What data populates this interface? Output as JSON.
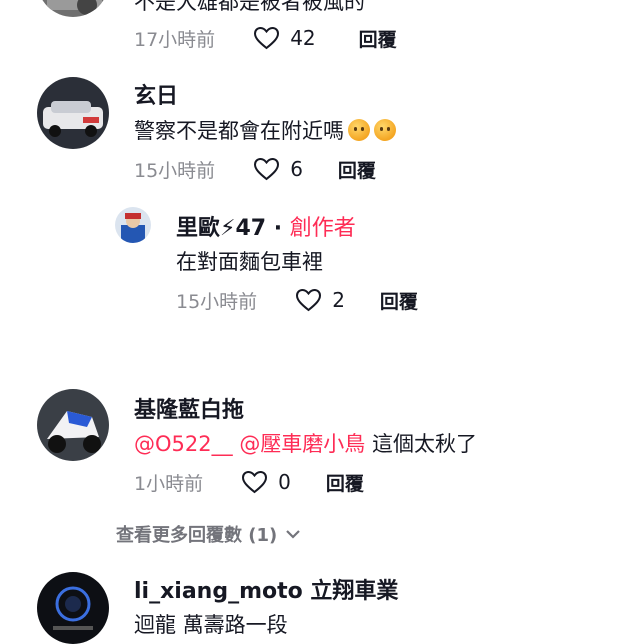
{
  "comments": [
    {
      "text_fragment": "不是大雄都是被者被風的",
      "time": "17小時前",
      "likes": "42",
      "reply": "回覆"
    },
    {
      "username": "玄日",
      "text": "警察不是都會在附近嗎",
      "emojis": [
        "thinking-face-emoji",
        "thinking-face-emoji"
      ],
      "time": "15小時前",
      "likes": "6",
      "reply": "回覆",
      "replies": [
        {
          "username": "里歐⚡47",
          "separator": "·",
          "creator_badge": "創作者",
          "text": "在對面麵包車裡",
          "time": "15小時前",
          "likes": "2",
          "reply": "回覆"
        }
      ]
    },
    {
      "username": "基隆藍白拖",
      "mention1": "@O522__",
      "mention2": "@壓車磨小鳥",
      "text": "這個太秋了",
      "time": "1小時前",
      "likes": "0",
      "reply": "回覆",
      "view_more": "查看更多回覆數 (1)"
    },
    {
      "username": "li_xiang_moto 立翔車業",
      "text": "迴龍 萬壽路一段"
    }
  ],
  "colors": {
    "text": "#161823",
    "muted": "#8a8b91",
    "accent": "#fe2c55"
  }
}
